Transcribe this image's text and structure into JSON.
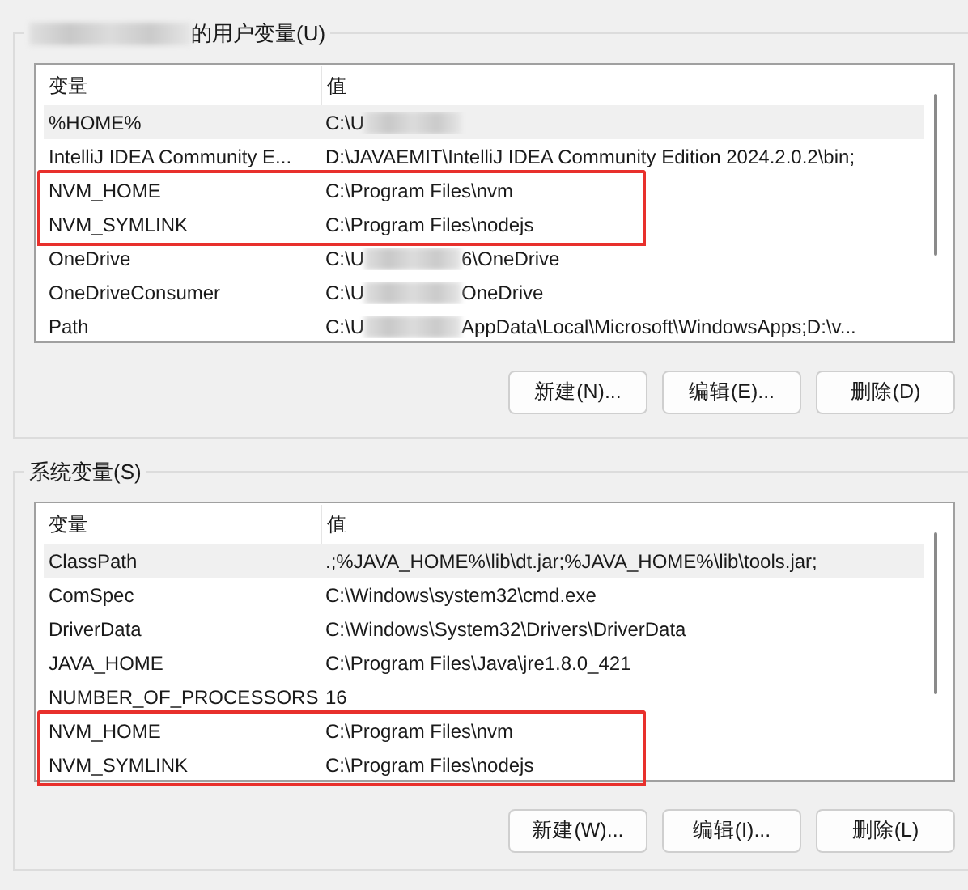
{
  "user_vars": {
    "title": "的用户变量(U)",
    "title_redacted": true,
    "columns": [
      "变量",
      "值"
    ],
    "rows": [
      {
        "name": "%HOME%",
        "value": "C:\\U",
        "value_after": "",
        "redacted": true,
        "selected": true,
        "annotated": false
      },
      {
        "name": "IntelliJ IDEA Community E...",
        "value": "D:\\JAVAEMIT\\IntelliJ IDEA Community Edition 2024.2.0.2\\bin;",
        "redacted": false,
        "selected": false,
        "annotated": false
      },
      {
        "name": "NVM_HOME",
        "value": "C:\\Program Files\\nvm",
        "redacted": false,
        "selected": false,
        "annotated": true
      },
      {
        "name": "NVM_SYMLINK",
        "value": "C:\\Program Files\\nodejs",
        "redacted": false,
        "selected": false,
        "annotated": true
      },
      {
        "name": "OneDrive",
        "value": "C:\\U",
        "value_after": "6\\OneDrive",
        "redacted": true,
        "selected": false,
        "annotated": false
      },
      {
        "name": "OneDriveConsumer",
        "value": "C:\\U",
        "value_after": "OneDrive",
        "redacted": true,
        "selected": false,
        "annotated": false
      },
      {
        "name": "Path",
        "value": "C:\\U",
        "value_after": "AppData\\Local\\Microsoft\\WindowsApps;D:\\v...",
        "redacted": true,
        "selected": false,
        "annotated": false
      }
    ],
    "buttons": [
      "新建(N)...",
      "编辑(E)...",
      "删除(D)"
    ]
  },
  "system_vars": {
    "title": "系统变量(S)",
    "title_redacted": false,
    "columns": [
      "变量",
      "值"
    ],
    "rows": [
      {
        "name": "ClassPath",
        "value": ".;%JAVA_HOME%\\lib\\dt.jar;%JAVA_HOME%\\lib\\tools.jar;",
        "redacted": false,
        "selected": true,
        "annotated": false
      },
      {
        "name": "ComSpec",
        "value": "C:\\Windows\\system32\\cmd.exe",
        "redacted": false,
        "selected": false,
        "annotated": false
      },
      {
        "name": "DriverData",
        "value": "C:\\Windows\\System32\\Drivers\\DriverData",
        "redacted": false,
        "selected": false,
        "annotated": false
      },
      {
        "name": "JAVA_HOME",
        "value": "C:\\Program Files\\Java\\jre1.8.0_421",
        "redacted": false,
        "selected": false,
        "annotated": false
      },
      {
        "name": "NUMBER_OF_PROCESSORS",
        "value": "16",
        "redacted": false,
        "selected": false,
        "annotated": false
      },
      {
        "name": "NVM_HOME",
        "value": "C:\\Program Files\\nvm",
        "redacted": false,
        "selected": false,
        "annotated": true
      },
      {
        "name": "NVM_SYMLINK",
        "value": "C:\\Program Files\\nodejs",
        "redacted": false,
        "selected": false,
        "annotated": true
      }
    ],
    "buttons": [
      "新建(W)...",
      "编辑(I)...",
      "删除(L)"
    ]
  }
}
